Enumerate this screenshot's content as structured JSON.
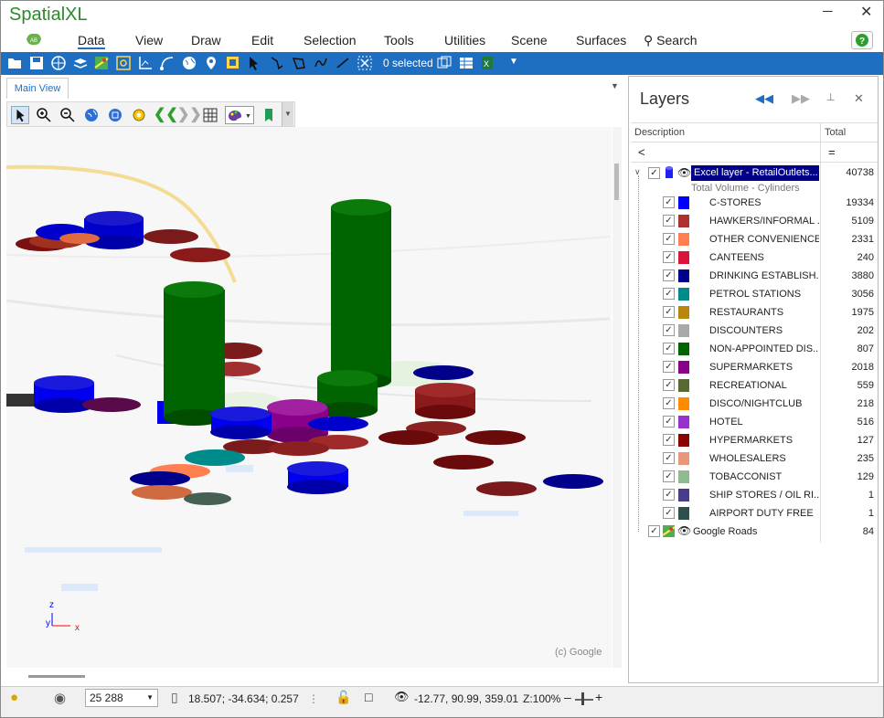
{
  "app": {
    "title": "SpatialXL"
  },
  "menu": {
    "items": [
      "Data",
      "View",
      "Draw",
      "Edit",
      "Selection",
      "Tools",
      "Utilities",
      "Scene",
      "Surfaces"
    ],
    "search_label": "Search"
  },
  "toolbar": {
    "selected_count": "0 selected"
  },
  "view": {
    "tab_label": "Main View",
    "google_credit": "(c) Google",
    "axis_z": "z",
    "axis_y": "y",
    "axis_x": "x"
  },
  "panel": {
    "title": "Layers",
    "col_description": "Description",
    "col_total": "Total",
    "filter_left": "<",
    "filter_right": "="
  },
  "layers": {
    "main": {
      "name": "Excel layer - RetailOutlets...",
      "total": "40738",
      "subtitle": "Total Volume - Cylinders"
    },
    "categories": [
      {
        "label": "C-STORES",
        "value": "19334",
        "color": "#0000ff"
      },
      {
        "label": "HAWKERS/INFORMAL ...",
        "value": "5109",
        "color": "#b03030"
      },
      {
        "label": "OTHER CONVENIENCE",
        "value": "2331",
        "color": "#ff7f50"
      },
      {
        "label": "CANTEENS",
        "value": "240",
        "color": "#dc143c"
      },
      {
        "label": "DRINKING ESTABLISH...",
        "value": "3880",
        "color": "#00008b"
      },
      {
        "label": "PETROL STATIONS",
        "value": "3056",
        "color": "#008b8b"
      },
      {
        "label": "RESTAURANTS",
        "value": "1975",
        "color": "#b8860b"
      },
      {
        "label": "DISCOUNTERS",
        "value": "202",
        "color": "#a9a9a9"
      },
      {
        "label": "NON-APPOINTED DIS...",
        "value": "807",
        "color": "#006400"
      },
      {
        "label": "SUPERMARKETS",
        "value": "2018",
        "color": "#8b008b"
      },
      {
        "label": "RECREATIONAL",
        "value": "559",
        "color": "#556b2f"
      },
      {
        "label": "DISCO/NIGHTCLUB",
        "value": "218",
        "color": "#ff8c00"
      },
      {
        "label": "HOTEL",
        "value": "516",
        "color": "#9932cc"
      },
      {
        "label": "HYPERMARKETS",
        "value": "127",
        "color": "#8b0000"
      },
      {
        "label": "WHOLESALERS",
        "value": "235",
        "color": "#e9967a"
      },
      {
        "label": "TOBACCONIST",
        "value": "129",
        "color": "#8fbc8f"
      },
      {
        "label": "SHIP STORES / OIL RI...",
        "value": "1",
        "color": "#483d8b"
      },
      {
        "label": "AIRPORT DUTY FREE",
        "value": "1",
        "color": "#2f4f4f"
      }
    ],
    "google": {
      "name": "Google Roads",
      "total": "84"
    }
  },
  "status": {
    "zoom_value": "25 288",
    "coords": "18.507; -34.634; 0.257",
    "view_params": "-12.77, 90.99, 359.01",
    "zoom_pct": "Z:100%"
  }
}
